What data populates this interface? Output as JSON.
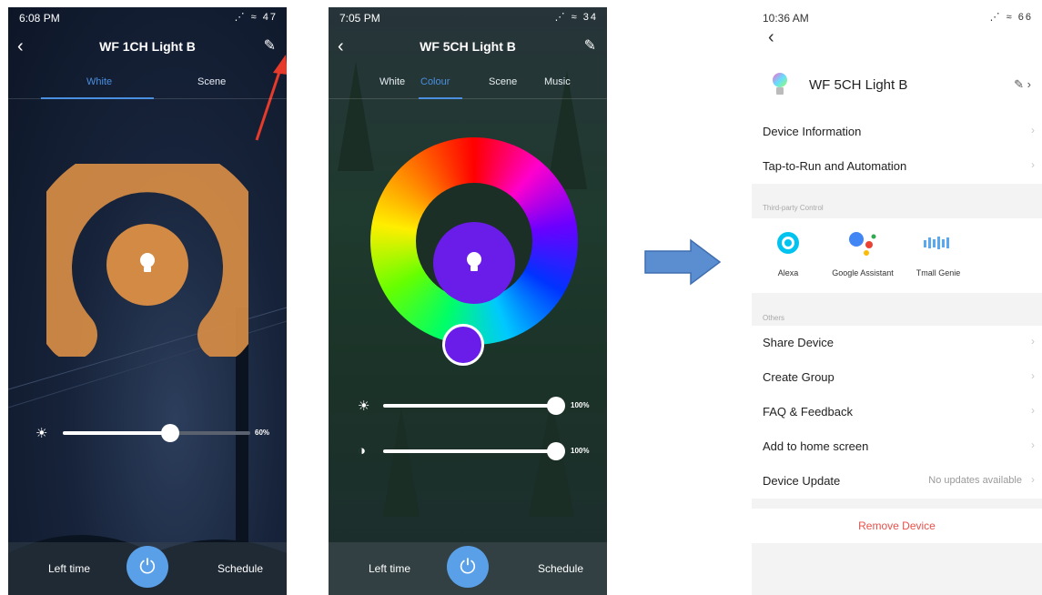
{
  "screen1": {
    "time": "6:08 PM",
    "status_icons": "⋰ ≈ 47",
    "title": "WF 1CH Light B",
    "tabs": [
      "White",
      "Scene"
    ],
    "brightness_value": "60%",
    "left_time": "Left time",
    "schedule": "Schedule",
    "ring_color": "#d28a45",
    "level": 0.6
  },
  "screen2": {
    "time": "7:05 PM",
    "status_icons": "⋰ ≈ 34",
    "title": "WF 5CH Light B",
    "tabs": [
      "White",
      "Colour",
      "Scene",
      "Music"
    ],
    "brightness_value": "100%",
    "contrast_value": "100%",
    "left_time": "Left time",
    "schedule": "Schedule",
    "center_color": "#6a1ce8"
  },
  "screen3": {
    "time": "10:36 AM",
    "status_icons": "⋰ ≈ 66",
    "device_name": "WF 5CH Light B",
    "rows_top": [
      "Device Information",
      "Tap-to-Run and Automation"
    ],
    "third_party_header": "Third-party Control",
    "third_party": [
      {
        "label": "Alexa",
        "icon": "alexa-icon"
      },
      {
        "label": "Google Assistant",
        "icon": "google-assistant-icon"
      },
      {
        "label": "Tmall Genie",
        "icon": "tmall-genie-icon"
      }
    ],
    "others_header": "Others",
    "rows_others": [
      "Share Device",
      "Create Group",
      "FAQ & Feedback",
      "Add to home screen"
    ],
    "device_update_label": "Device Update",
    "device_update_status": "No updates available",
    "remove_label": "Remove Device",
    "remove_color": "#e8514b"
  },
  "arrow_color": "#5b8ed0",
  "annotation_arrow_color": "#e63a2b"
}
